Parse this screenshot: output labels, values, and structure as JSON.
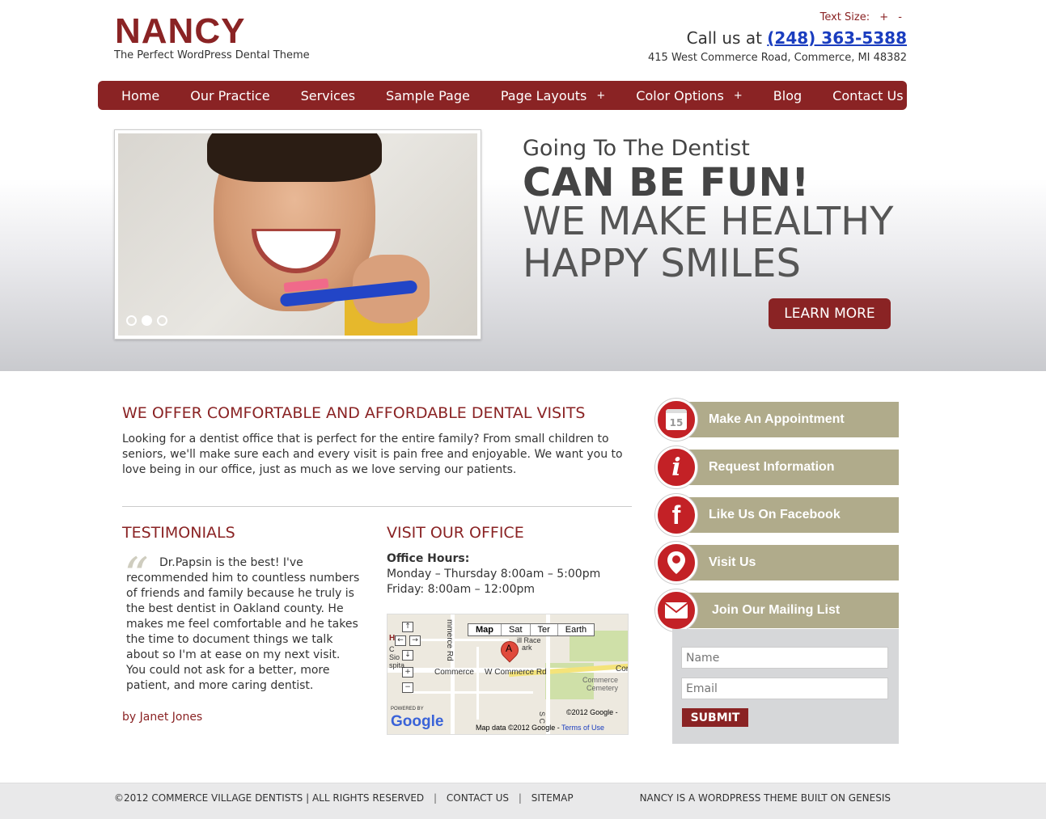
{
  "header": {
    "site_title": "NANCY",
    "tagline": "The Perfect WordPress Dental Theme",
    "text_size_label": "Text Size:",
    "text_size_plus": "+",
    "text_size_minus": "-",
    "call_prefix": "Call us at",
    "phone": "(248) 363-5388",
    "address": "415 West Commerce Road, Commerce, MI 48382"
  },
  "nav": {
    "items": [
      {
        "label": "Home"
      },
      {
        "label": "Our Practice"
      },
      {
        "label": "Services"
      },
      {
        "label": "Sample Page"
      },
      {
        "label": "Page Layouts",
        "has_sub": "+"
      },
      {
        "label": "Color Options",
        "has_sub": "+"
      },
      {
        "label": "Blog"
      },
      {
        "label": "Contact Us"
      }
    ]
  },
  "hero": {
    "line1": "Going To The Dentist",
    "line2": "CAN BE FUN!",
    "line3": "WE MAKE HEALTHY HAPPY SMILES",
    "cta": "LEARN MORE",
    "slides": 3,
    "active_slide": 2
  },
  "offer": {
    "heading": "WE OFFER COMFORTABLE AND AFFORDABLE DENTAL VISITS",
    "body": "Looking for a dentist office that is perfect for the entire family? From small children to seniors, we'll make sure each and every visit is pain free and enjoyable. We want you to love being in our office, just as much as we love serving our patients."
  },
  "testimonials": {
    "heading": "TESTIMONIALS",
    "quote_mark": "“",
    "text": "Dr.Papsin is the best! I've recommended him to countless numbers of friends and family because he truly is the best dentist in Oakland county. He makes me feel comfortable and he takes the time to document things we talk about so I'm at ease on my next visit. You could not ask for a better, more patient, and more caring dentist.",
    "author": "by Janet Jones"
  },
  "visit": {
    "heading": "VISIT OUR OFFICE",
    "hours_title": "Office Hours:",
    "hours_line1": "Monday – Thursday 8:00am – 5:00pm",
    "hours_line2": "Friday: 8:00am – 12:00pm"
  },
  "map": {
    "types": [
      "Map",
      "Sat",
      "Ter",
      "Earth"
    ],
    "ctrl_up": "↑",
    "ctrl_left": "←",
    "ctrl_right": "→",
    "ctrl_down": "↓",
    "ctrl_zoom_in": "+",
    "ctrl_zoom_out": "−",
    "pin_letter": "A",
    "label_commerce": "Commerce",
    "label_road": "W Commerce Rd",
    "label_cemetery_1": "Commerce",
    "label_cemetery_2": "Cemetery",
    "label_cor": "Cor",
    "label_vertical_road": "mmerce Rd",
    "label_park": "ark",
    "label_race": "ill Race",
    "label_s_c": "S C",
    "label_h": "H",
    "label_c": "C",
    "label_sio": "Sio",
    "label_spita": "spita",
    "powered_by": "POWERED BY",
    "google": "Google",
    "copyright": "©2012 Google -",
    "map_data": "Map data ©2012 Google -",
    "terms": "Terms of Use"
  },
  "sidebar": {
    "buttons": [
      {
        "label": "Make An Appointment",
        "icon": "calendar-icon",
        "glyph": "15"
      },
      {
        "label": "Request Information",
        "icon": "info-icon",
        "glyph": "i"
      },
      {
        "label": "Like Us On Facebook",
        "icon": "facebook-icon",
        "glyph": "f"
      },
      {
        "label": "Visit Us",
        "icon": "location-pin-icon",
        "glyph": "◉"
      },
      {
        "label": "Join Our Mailing List",
        "icon": "envelope-icon",
        "glyph": "✉"
      }
    ],
    "name_placeholder": "Name",
    "email_placeholder": "Email",
    "submit": "SUBMIT"
  },
  "footer": {
    "copyright": "©2012 COMMERCE VILLAGE DENTISTS | ALL RIGHTS RESERVED",
    "sep": "|",
    "contact": "CONTACT US",
    "sitemap": "SITEMAP",
    "right": "NANCY IS A WORDPRESS THEME BUILT ON GENESIS"
  },
  "colors": {
    "brand": "#8a2324",
    "sidebar_bar": "#b0ab8b",
    "sidebar_circle": "#c32126"
  }
}
